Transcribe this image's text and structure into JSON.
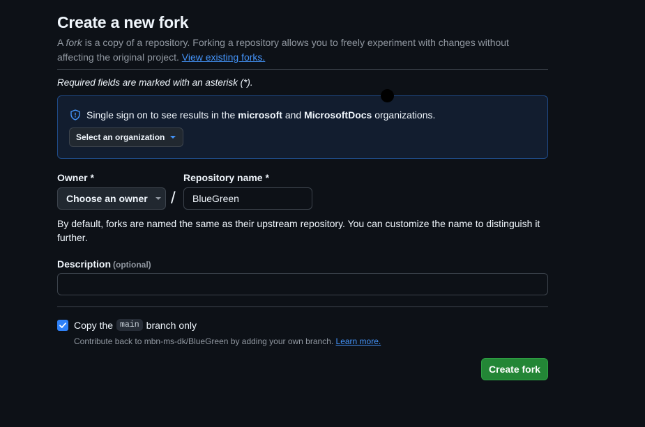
{
  "header": {
    "title": "Create a new fork",
    "lede_prefix": "A ",
    "lede_fork_word": "fork",
    "lede_body": " is a copy of a repository. Forking a repository allows you to freely experiment with changes without affecting the original project. ",
    "view_forks_link": "View existing forks."
  },
  "required_note": "Required fields are marked with an asterisk (*).",
  "sso": {
    "text_prefix": "Single sign on to see results in the ",
    "org1": "microsoft",
    "text_mid": " and ",
    "org2": "MicrosoftDocs",
    "text_suffix": " organizations.",
    "select_label": "Select an organization"
  },
  "owner": {
    "label": "Owner *",
    "button_label": "Choose an owner"
  },
  "slash": "/",
  "repository": {
    "label": "Repository name *",
    "value": "BlueGreen"
  },
  "helper_text": "By default, forks are named the same as their upstream repository. You can customize the name to distinguish it further.",
  "description": {
    "label": "Description",
    "optional": "(optional)",
    "value": ""
  },
  "copy_branch": {
    "checked": true,
    "text_prefix": "Copy the",
    "branch": "main",
    "text_suffix": "branch only",
    "contrib_text": "Contribute back to mbn-ms-dk/BlueGreen by adding your own branch. ",
    "learn_more": "Learn more."
  },
  "create_button": "Create fork",
  "colors": {
    "background": "#0d1117",
    "link": "#4493f8",
    "primary_button": "#238636",
    "checkbox": "#2f81f7"
  },
  "icons": [
    "shield-icon",
    "chevron-down-icon",
    "checkmark-icon"
  ]
}
